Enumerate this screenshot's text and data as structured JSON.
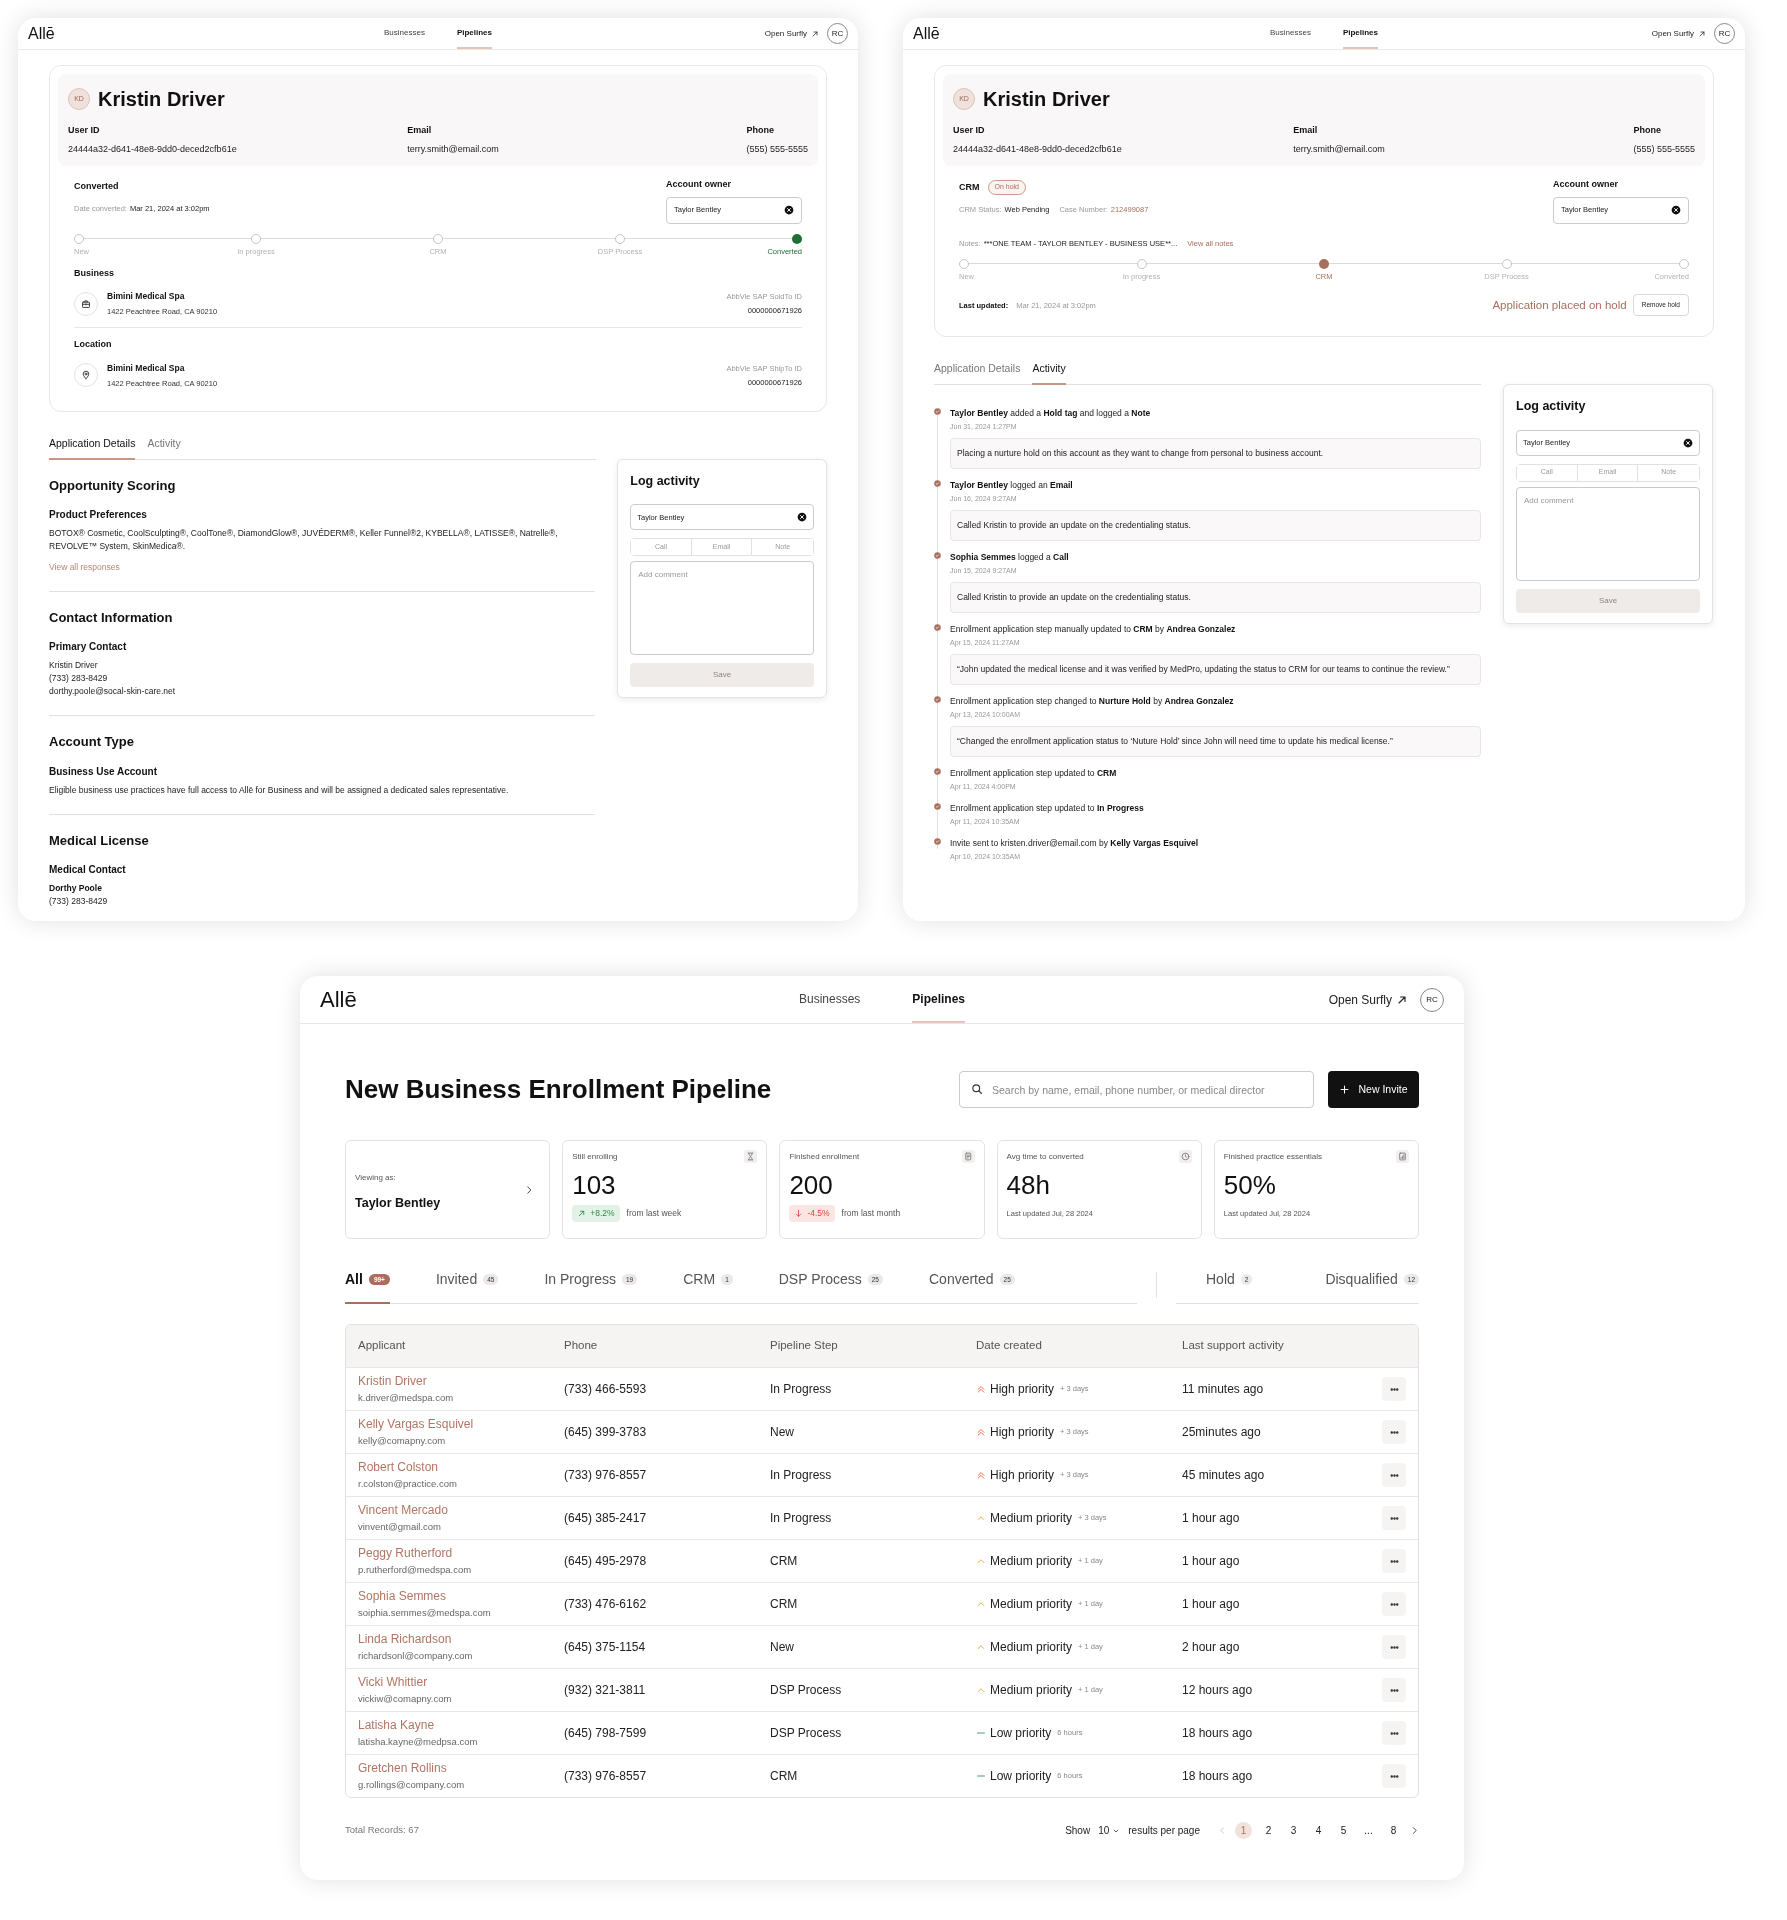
{
  "detail_windows": [
    {
      "nav": {
        "logo": "Allē",
        "links": [
          {
            "label": "Businesses",
            "selected": false
          },
          {
            "label": "Pipelines",
            "selected": true
          }
        ],
        "open_link": "Open Surfly",
        "avatar": "RC"
      },
      "profile": {
        "initials": "KD",
        "name": "Kristin Driver",
        "fields": [
          {
            "label": "User ID",
            "value": "24444a32-d641-48e8-9dd0-deced2cfb61e"
          },
          {
            "label": "Email",
            "value": "terry.smith@email.com"
          },
          {
            "label": "Phone",
            "value": "(555) 555-5555"
          }
        ]
      },
      "status": {
        "kind": "converted",
        "title": "Converted",
        "date_label": "Date converted:",
        "date": "Mar 21, 2024 at 3:02pm"
      },
      "account_owner": {
        "label": "Account owner",
        "value": "Taylor Bentley"
      },
      "steps": [
        {
          "label": "New",
          "selected": false
        },
        {
          "label": "In progress",
          "selected": false
        },
        {
          "label": "CRM",
          "selected": false
        },
        {
          "label": "DSP Process",
          "selected": false
        },
        {
          "label": "Converted",
          "selected": true
        }
      ],
      "records": [
        {
          "kind": "business",
          "title": "Business",
          "name": "Bimini Medical Spa",
          "address": "1422 Peachtree Road, CA 90210",
          "id_label": "AbbVie SAP SoldTo ID",
          "id_value": "0000000671926"
        },
        {
          "kind": "location",
          "title": "Location",
          "name": "Bimini Medical Spa",
          "address": "1422 Peachtree Road, CA 90210",
          "id_label": "AbbVie SAP ShipTo ID",
          "id_value": "0000000671926"
        }
      ],
      "tabs": [
        {
          "label": "Application Details",
          "selected": true
        },
        {
          "label": "Activity",
          "selected": false
        }
      ],
      "panel": {
        "kind": "details",
        "sections": [
          {
            "title": "Opportunity Scoring",
            "heading": "Product Preferences",
            "lines": [
              "BOTOX® Cosmetic, CoolSculpting®, CoolTone®, DiamondGlow®, JUVÉDERM®, Keller Funnel®2, KYBELLA®, LATISSE®, Natrelle®, REVOLVE™ System, SkinMedica®."
            ],
            "link": "View all responses"
          },
          {
            "title": "Contact Information",
            "heading": "Primary Contact",
            "lines": [
              "Kristin Driver",
              "(733) 283-8429",
              "dorthy.poole@socal-skin-care.net"
            ]
          },
          {
            "title": "Account Type",
            "heading": "Business Use Account",
            "lines": [
              "Eligible business use practices have full access to Allē for Business and will be assigned a dedicated sales representative."
            ]
          },
          {
            "title": "Medical License",
            "heading": "Medical Contact",
            "contact_name": "Dorthy Poole",
            "lines": [
              "(733) 283-8429"
            ]
          }
        ]
      },
      "log_activity": {
        "title": "Log activity",
        "owner": "Taylor Bentley",
        "types": [
          {
            "label": "Call",
            "selected": false
          },
          {
            "label": "Email",
            "selected": false
          },
          {
            "label": "Note",
            "selected": false
          }
        ],
        "placeholder": "Add comment",
        "save": "Save",
        "disabled": true
      }
    },
    {
      "nav": {
        "logo": "Allē",
        "links": [
          {
            "label": "Businesses",
            "selected": false
          },
          {
            "label": "Pipelines",
            "selected": true
          }
        ],
        "open_link": "Open Surfly",
        "avatar": "RC"
      },
      "profile": {
        "initials": "KD",
        "name": "Kristin Driver",
        "fields": [
          {
            "label": "User ID",
            "value": "24444a32-d641-48e8-9dd0-deced2cfb61e"
          },
          {
            "label": "Email",
            "value": "terry.smith@email.com"
          },
          {
            "label": "Phone",
            "value": "(555) 555-5555"
          }
        ]
      },
      "status": {
        "kind": "crm",
        "title": "CRM",
        "badge": "On hold",
        "crm_status_label": "CRM Status:",
        "crm_status": "Web Pending",
        "case_label": "Case Number:",
        "case_number": "212499087",
        "notes_label": "Notes:",
        "notes": "***ONE TEAM - TAYLOR BENTLEY - BUSINESS USE**...",
        "notes_link": "View all notes",
        "updated_label": "Last updated:",
        "updated": "Mar 21, 2024 at 3:02pm",
        "hold_message": "Application placed on hold",
        "hold_button": "Remove hold"
      },
      "account_owner": {
        "label": "Account owner",
        "value": "Taylor Bentley"
      },
      "steps": [
        {
          "label": "New",
          "selected": false
        },
        {
          "label": "In progress",
          "selected": false
        },
        {
          "label": "CRM",
          "selected": true
        },
        {
          "label": "DSP Process",
          "selected": false
        },
        {
          "label": "Converted",
          "selected": false
        }
      ],
      "tabs": [
        {
          "label": "Application Details",
          "selected": false
        },
        {
          "label": "Activity",
          "selected": true
        }
      ],
      "panel": {
        "kind": "activity",
        "items": [
          {
            "text": "**Taylor Bentley** added a **Hold tag** and logged a **Note**",
            "time": "Jun 31, 2024 1:27PM",
            "comment": "Placing a nurture hold on this account as they want to change from personal to business account."
          },
          {
            "text": "**Taylor Bentley** logged an **Email**",
            "time": "Jun 16, 2024 9:27AM",
            "comment": "Called Kristin to provide an update on the credentialing status."
          },
          {
            "text": "**Sophia Semmes** logged a **Call**",
            "time": "Jun 15, 2024 9:27AM",
            "comment": "Called Kristin to provide an update on the credentialing status."
          },
          {
            "text": "Enrollment application step manually updated to **CRM** by **Andrea Gonzalez**",
            "time": "Apr 15, 2024 11:27AM",
            "comment": "“John updated the medical license and it was verified by MedPro, updating the status to CRM for our teams to continue the review.”"
          },
          {
            "text": "Enrollment application step changed to **Nurture Hold** by **Andrea Gonzalez**",
            "time": "Apr 13, 2024 10:00AM",
            "comment": "“Changed the enrollment application status to ‘Nuture Hold’ since John will need time to update his medical license.”"
          },
          {
            "text": "Enrollment application step updated to **CRM**",
            "time": "Apr 11, 2024 4:00PM"
          },
          {
            "text": "Enrollment application step updated to **In Progress**",
            "time": "Apr 11, 2024 10:35AM"
          },
          {
            "text": "Invite sent to kristen.driver@email.com by **Kelly Vargas Esquivel**",
            "time": "Apr 10, 2024 10:35AM"
          }
        ]
      },
      "log_activity": {
        "title": "Log activity",
        "owner": "Taylor Bentley",
        "types": [
          {
            "label": "Call",
            "selected": false
          },
          {
            "label": "Email",
            "selected": false
          },
          {
            "label": "Note",
            "selected": false
          }
        ],
        "placeholder": "Add comment",
        "save": "Save",
        "disabled": true
      }
    }
  ],
  "pipeline_window": {
    "nav": {
      "logo": "Allē",
      "links": [
        {
          "label": "Businesses",
          "selected": false
        },
        {
          "label": "Pipelines",
          "selected": true
        }
      ],
      "open_link": "Open Surfly",
      "avatar": "RC"
    },
    "title": "New Business Enrollment Pipeline",
    "search": {
      "placeholder": "Search by name, email, phone number, or medical director"
    },
    "new_button": "New Invite",
    "viewer": {
      "label": "Viewing as:",
      "name": "Taylor Bentley"
    },
    "stats": [
      {
        "label": "Still enrolling",
        "value": "103",
        "trend": {
          "kind": "up",
          "text": "+8.2%"
        },
        "note": "from last week"
      },
      {
        "label": "Finished enrollment",
        "value": "200",
        "trend": {
          "kind": "down",
          "text": "-4.5%"
        },
        "note": "from last month"
      },
      {
        "label": "Avg time to converted",
        "value": "48h",
        "note": "Last updated Jul, 28 2024"
      },
      {
        "label": "Finished practice essentials",
        "value": "50%",
        "note": "Last updated Jul, 28 2024"
      }
    ],
    "filters": [
      {
        "label": "All",
        "count": "99+",
        "selected": true
      },
      {
        "label": "Invited",
        "count": "45",
        "selected": false
      },
      {
        "label": "In Progress",
        "count": "19",
        "selected": false
      },
      {
        "label": "CRM",
        "count": "1",
        "selected": false
      },
      {
        "label": "DSP Process",
        "count": "25",
        "selected": false
      },
      {
        "label": "Converted",
        "count": "25",
        "selected": false
      }
    ],
    "filters_secondary": [
      {
        "label": "Hold",
        "count": "2",
        "selected": false
      },
      {
        "label": "Disqualified",
        "count": "12",
        "selected": false
      }
    ],
    "columns": [
      "Applicant",
      "Phone",
      "Pipeline Step",
      "Date created",
      "Last support activity"
    ],
    "rows": [
      {
        "name": "Kristin Driver",
        "email": "k.driver@medspa.com",
        "phone": "(733) 466-5593",
        "step": "In Progress",
        "priority": {
          "kind": "high",
          "label": "High priority",
          "age": "+ 3 days"
        },
        "activity": "11 minutes ago"
      },
      {
        "name": "Kelly Vargas Esquivel",
        "email": "kelly@comapny.com",
        "phone": "(645) 399-3783",
        "step": "New",
        "priority": {
          "kind": "high",
          "label": "High priority",
          "age": "+ 3 days"
        },
        "activity": "25minutes ago"
      },
      {
        "name": "Robert Colston",
        "email": "r.colston@practice.com",
        "phone": "(733) 976-8557",
        "step": "In Progress",
        "priority": {
          "kind": "high",
          "label": "High priority",
          "age": "+ 3 days"
        },
        "activity": "45 minutes ago"
      },
      {
        "name": "Vincent Mercado",
        "email": "vinvent@gmail.com",
        "phone": "(645) 385-2417",
        "step": "In Progress",
        "priority": {
          "kind": "medium",
          "label": "Medium priority",
          "age": "+ 3 days"
        },
        "activity": "1 hour ago"
      },
      {
        "name": "Peggy Rutherford",
        "email": "p.rutherford@medspa.com",
        "phone": "(645) 495-2978",
        "step": "CRM",
        "priority": {
          "kind": "medium",
          "label": "Medium priority",
          "age": "+ 1 day"
        },
        "activity": "1 hour ago"
      },
      {
        "name": "Sophia Semmes",
        "email": "soiphia.semmes@medspa.com",
        "phone": "(733) 476-6162",
        "step": "CRM",
        "priority": {
          "kind": "medium",
          "label": "Medium priority",
          "age": "+ 1 day"
        },
        "activity": "1 hour ago"
      },
      {
        "name": "Linda Richardson",
        "email": "richardsonl@company.com",
        "phone": "(645) 375-1154",
        "step": "New",
        "priority": {
          "kind": "medium",
          "label": "Medium priority",
          "age": "+ 1 day"
        },
        "activity": "2 hour ago"
      },
      {
        "name": "Vicki Whittier",
        "email": "vickiw@comapny.com",
        "phone": "(932) 321-3811",
        "step": "DSP Process",
        "priority": {
          "kind": "medium",
          "label": "Medium priority",
          "age": "+ 1 day"
        },
        "activity": "12 hours ago"
      },
      {
        "name": "Latisha Kayne",
        "email": "latisha.kayne@medpsa.com",
        "phone": "(645) 798-7599",
        "step": "DSP Process",
        "priority": {
          "kind": "low",
          "label": "Low priority",
          "age": "6 hours"
        },
        "activity": "18 hours ago"
      },
      {
        "name": "Gretchen Rollins",
        "email": "g.rollings@company.com",
        "phone": "(733) 976-8557",
        "step": "CRM",
        "priority": {
          "kind": "low",
          "label": "Low priority",
          "age": "6 hours"
        },
        "activity": "18 hours ago"
      }
    ],
    "footer": {
      "total": "Total Records: 67",
      "show": "Show",
      "per_page": "10",
      "per_page_suffix": "results per page",
      "pages": [
        {
          "label": "1",
          "selected": true
        },
        {
          "label": "2",
          "selected": false
        },
        {
          "label": "3",
          "selected": false
        },
        {
          "label": "4",
          "selected": false
        },
        {
          "label": "5",
          "selected": false
        },
        {
          "label": "...",
          "selected": false
        },
        {
          "label": "8",
          "selected": false
        }
      ]
    }
  }
}
